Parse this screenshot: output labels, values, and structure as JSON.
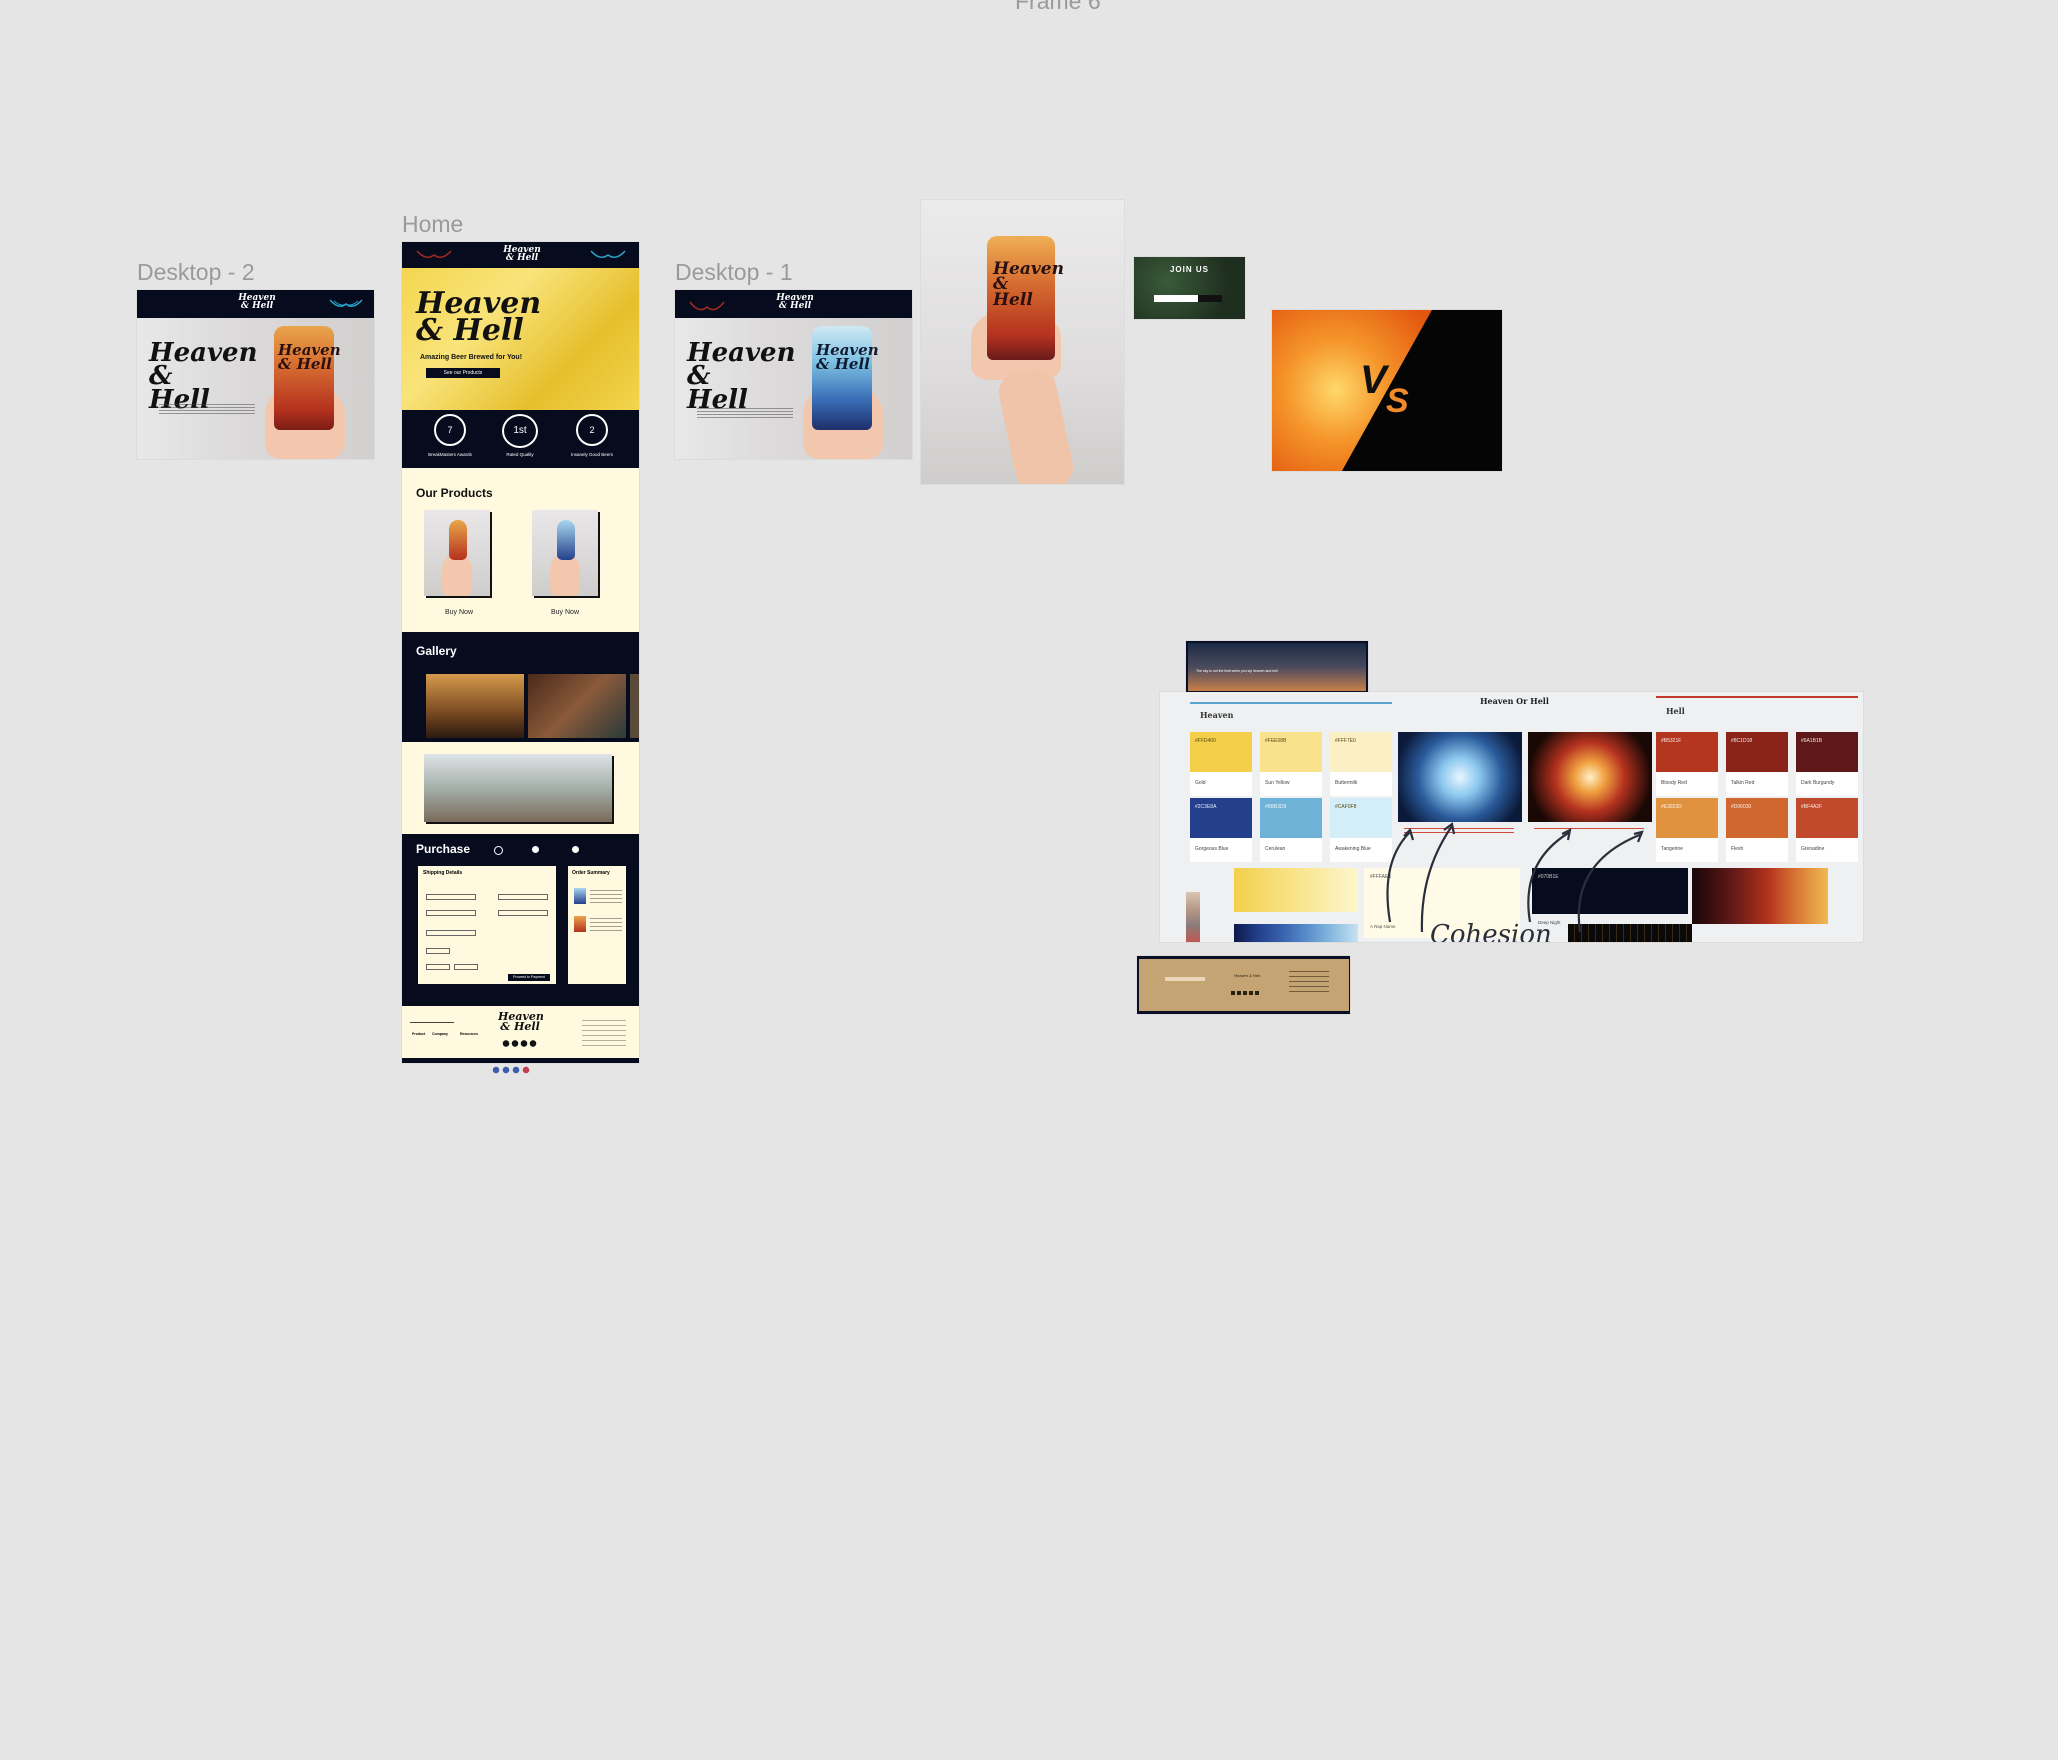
{
  "canvas": {
    "top_label": "Frame 6"
  },
  "frames": {
    "desktop2": {
      "label": "Desktop - 2",
      "logo": "Heaven & Hell",
      "hero_title": "Heaven & Hell",
      "can_label": "Heaven & Hell"
    },
    "home": {
      "label": "Home",
      "logo": "Heaven & Hell",
      "hero_title": "Heaven & Hell",
      "tagline": "Amazing Beer Brewed for You!",
      "cta": "See our Products",
      "awards": [
        {
          "badge": "7",
          "caption": "BreakMasters Awards"
        },
        {
          "badge": "1st",
          "caption": "Rated Quality"
        },
        {
          "badge": "2",
          "caption": "Insanely Good Beers"
        }
      ],
      "products_heading": "Our Products",
      "products": [
        {
          "buy_label": "Buy Now"
        },
        {
          "buy_label": "Buy Now"
        }
      ],
      "gallery_heading": "Gallery",
      "purchase_heading": "Purchase",
      "shipping_title": "Shipping Details",
      "order_title": "Order Summary",
      "order_button": "Proceed to Payment",
      "footer_logo": "Heaven & Hell",
      "footer_cols": [
        "Product",
        "Company",
        "Resources"
      ]
    },
    "desktop1": {
      "label": "Desktop - 1",
      "logo": "Heaven & Hell",
      "hero_title": "Heaven & Hell",
      "can_label": "Heaven & Hell"
    },
    "hand_can": {
      "can_label": "Heaven & Hell"
    },
    "join_us": {
      "title": "JOIN US"
    },
    "vs": {
      "v": "V",
      "s": "S"
    },
    "moodboard": {
      "title": "Heaven Or Hell",
      "heaven_label": "Heaven",
      "hell_label": "Hell",
      "heaven_swatches": [
        {
          "hex": "#FFD400",
          "name": "Gold",
          "color": "#f3cf4a"
        },
        {
          "hex": "#FEE08B",
          "name": "Sun Yellow",
          "color": "#f8e38c"
        },
        {
          "hex": "#FFF7E0",
          "name": "Buttermilk",
          "color": "#fbf0c4"
        },
        {
          "hex": "#2C3E8A",
          "name": "Gorgeous Blue",
          "color": "#24408c"
        },
        {
          "hex": "#6BB3D9",
          "name": "Cerulean",
          "color": "#6fb2d8"
        },
        {
          "hex": "#CAF0F8",
          "name": "Awakening Blue",
          "color": "#d3eef6"
        }
      ],
      "hell_swatches": [
        {
          "hex": "#B5321F",
          "name": "Bloody Red",
          "color": "#b5361f"
        },
        {
          "hex": "#8C1D18",
          "name": "Talkin Red",
          "color": "#8a2418"
        },
        {
          "hex": "#6A1B1B",
          "name": "Dark Burgundy",
          "color": "#5e1818"
        },
        {
          "hex": "#E3923D",
          "name": "Tangerine",
          "color": "#e1923f"
        },
        {
          "hex": "#D06030",
          "name": "Flesh",
          "color": "#d0672f"
        },
        {
          "hex": "#BF4A2F",
          "name": "Grenadine",
          "color": "#c14a2c"
        }
      ],
      "cream_note": "#FFFAE5",
      "cream_sub": "A Rap Name",
      "navy_note": "#070B1E",
      "navy_sub": "Deep Night",
      "handwriting": "Cohesion"
    },
    "footer_card": {
      "brand": "Heaven & Hell"
    },
    "airplane": {
      "caption": "The sky is not the limit when you sip heaven and hell"
    }
  }
}
